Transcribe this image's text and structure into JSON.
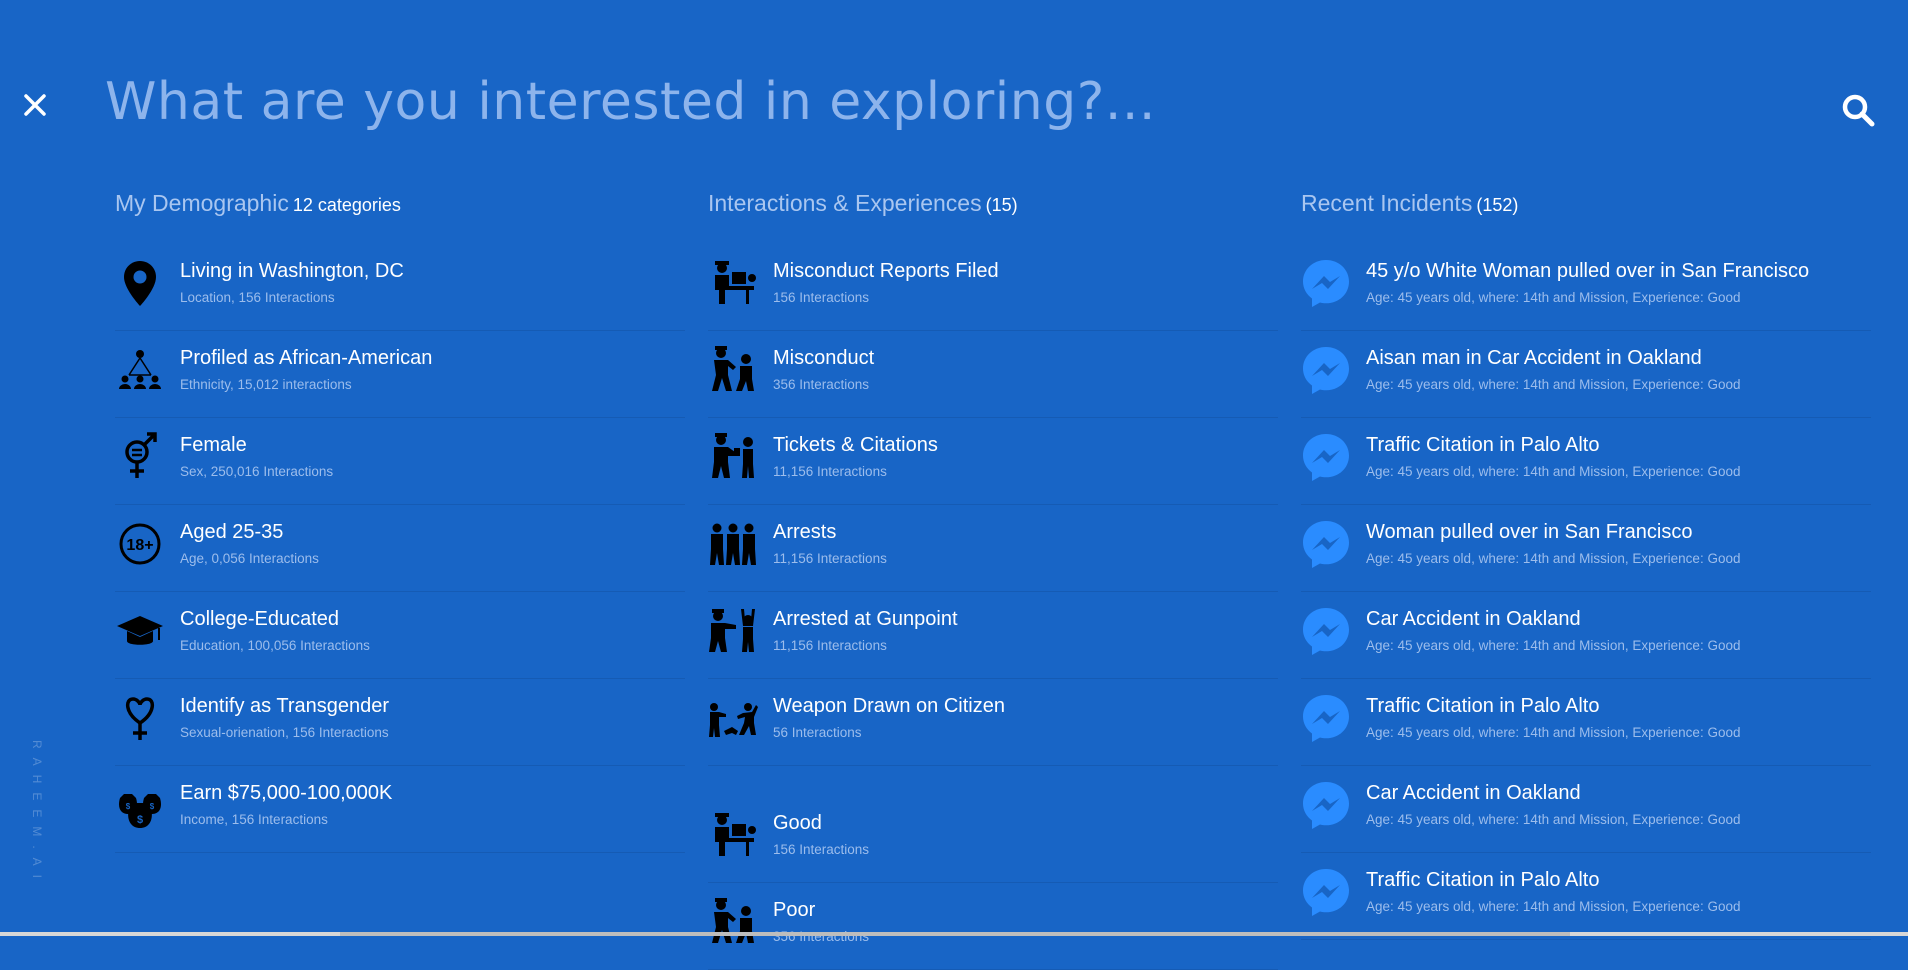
{
  "header": {
    "search_placeholder": "What are you interested in exploring?...",
    "close_icon": "close-icon",
    "search_icon": "search-icon"
  },
  "columns": [
    {
      "title": "My Demographic",
      "count": "12 categories",
      "items": [
        {
          "title": "Living in Washington, DC",
          "sub": "Location, 156 Interactions",
          "icon": "location-pin-icon"
        },
        {
          "title": "Profiled as African-American",
          "sub": "Ethnicity, 15,012 interactions",
          "icon": "people-network-icon"
        },
        {
          "title": "Female",
          "sub": "Sex, 250,016 Interactions",
          "icon": "gender-symbol-icon"
        },
        {
          "title": "Aged 25-35",
          "sub": "Age, 0,056 Interactions",
          "icon": "age-18-plus-icon"
        },
        {
          "title": "College-Educated",
          "sub": "Education, 100,056 Interactions",
          "icon": "graduation-cap-icon"
        },
        {
          "title": "Identify as Transgender",
          "sub": "Sexual-orienation, 156 Interactions",
          "icon": "heart-gender-icon"
        },
        {
          "title": "Earn $75,000-100,000K",
          "sub": "Income, 156 Interactions",
          "icon": "money-bags-icon"
        }
      ]
    },
    {
      "title": "Interactions & Experiences",
      "count": "(15)",
      "items": [
        {
          "title": "Misconduct Reports Filed",
          "sub": "156 Interactions",
          "icon": "officer-desk-icon"
        },
        {
          "title": "Misconduct",
          "sub": "356 Interactions",
          "icon": "officer-struggle-icon"
        },
        {
          "title": "Tickets & Citations",
          "sub": "11,156 Interactions",
          "icon": "officer-ticket-icon"
        },
        {
          "title": "Arrests",
          "sub": "11,156 Interactions",
          "icon": "arrest-group-icon"
        },
        {
          "title": "Arrested at Gunpoint",
          "sub": "11,156 Interactions",
          "icon": "gunpoint-icon"
        },
        {
          "title": "Weapon Drawn on Citizen",
          "sub": "56 Interactions",
          "icon": "weapon-drawn-icon"
        }
      ],
      "items_after_gap": [
        {
          "title": "Good",
          "sub": "156 Interactions",
          "icon": "officer-desk-icon"
        },
        {
          "title": "Poor",
          "sub": "356 Interactions",
          "icon": "officer-struggle-icon"
        }
      ]
    },
    {
      "title": "Recent Incidents",
      "count": "(152)",
      "items": [
        {
          "title": "45 y/o White Woman pulled over in San Francisco",
          "sub": "Age: 45 years old, where: 14th and Mission, Experience: Good",
          "icon": "messenger-icon"
        },
        {
          "title": "Aisan man in Car Accident in Oakland",
          "sub": "Age: 45 years old, where: 14th and Mission, Experience: Good",
          "icon": "messenger-icon"
        },
        {
          "title": "Traffic Citation in Palo Alto",
          "sub": "Age: 45 years old, where: 14th and Mission, Experience: Good",
          "icon": "messenger-icon"
        },
        {
          "title": "Woman pulled over in San Francisco",
          "sub": "Age: 45 years old, where: 14th and Mission, Experience: Good",
          "icon": "messenger-icon"
        },
        {
          "title": "Car Accident in Oakland",
          "sub": "Age: 45 years old, where: 14th and Mission, Experience: Good",
          "icon": "messenger-icon"
        },
        {
          "title": "Traffic Citation in Palo Alto",
          "sub": "Age: 45 years old, where: 14th and Mission, Experience: Good",
          "icon": "messenger-icon"
        },
        {
          "title": "Car Accident in Oakland",
          "sub": "Age: 45 years old, where: 14th and Mission, Experience: Good",
          "icon": "messenger-icon"
        },
        {
          "title": "Traffic Citation in Palo Alto",
          "sub": "Age: 45 years old, where: 14th and Mission, Experience: Good",
          "icon": "messenger-icon"
        }
      ]
    }
  ],
  "watermark": "RAHEEM.AI",
  "colors": {
    "background": "#1865c6",
    "messenger_blue": "#2a8cff",
    "subtext": "#9cbdec"
  }
}
